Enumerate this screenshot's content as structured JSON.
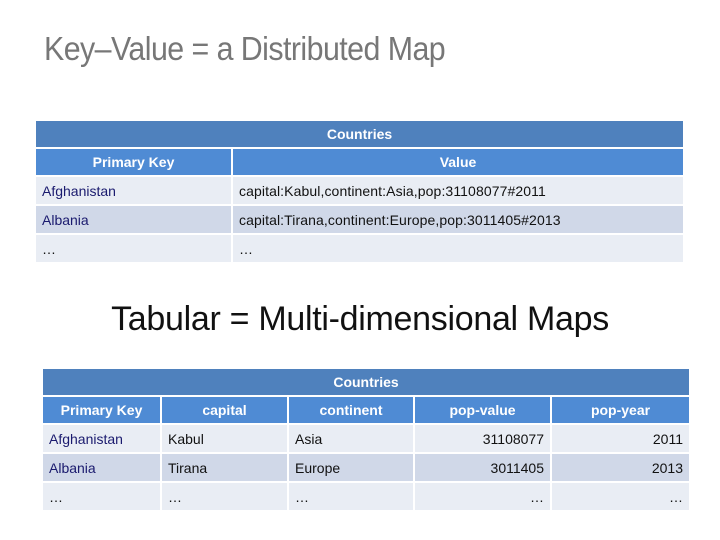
{
  "slide": {
    "title": "Key–Value = a Distributed Map",
    "subtitle": "Tabular = Multi-dimensional Maps"
  },
  "key_value_table": {
    "caption": "Countries",
    "columns": [
      "Primary Key",
      "Value"
    ],
    "rows": [
      [
        "Afghanistan",
        "capital:Kabul,continent:Asia,pop:31108077#2011"
      ],
      [
        "Albania",
        "capital:Tirana,continent:Europe,pop:3011405#2013"
      ],
      [
        "…",
        "…"
      ]
    ]
  },
  "tabular_table": {
    "caption": "Countries",
    "columns": [
      "Primary Key",
      "capital",
      "continent",
      "pop-value",
      "pop-year"
    ],
    "rows": [
      [
        "Afghanistan",
        "Kabul",
        "Asia",
        "31108077",
        "2011"
      ],
      [
        "Albania",
        "Tirana",
        "Europe",
        "3011405",
        "2013"
      ],
      [
        "…",
        "…",
        "…",
        "…",
        "…"
      ]
    ]
  },
  "colors": {
    "caption_bg": "#4f81bd",
    "header_bg": "#4f8bd4",
    "row_light": "#e9edf4",
    "row_dark": "#d0d8e8",
    "key_text": "#1a1a6e"
  }
}
